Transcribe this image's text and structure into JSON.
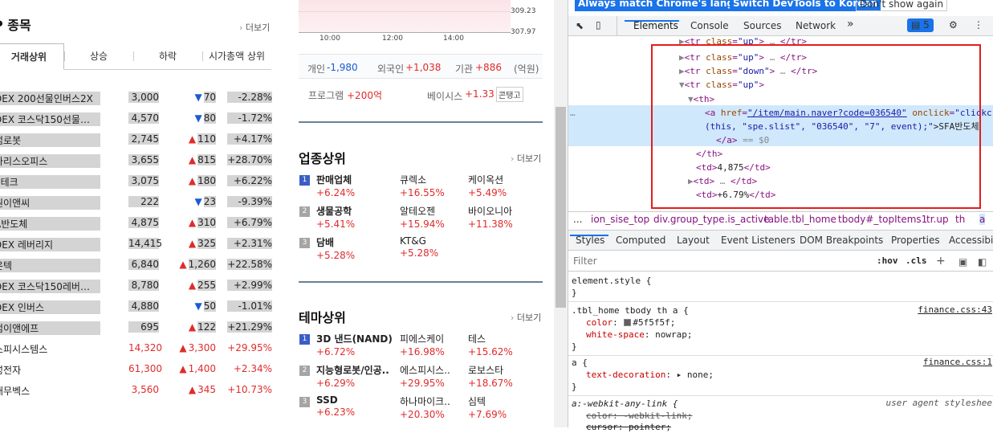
{
  "left": {
    "title": "P 종목",
    "more": "더보기",
    "tabs": [
      "거래상위",
      "상승",
      "하락",
      "시가총액 상위"
    ],
    "rows": [
      {
        "name": "DEX 200선물인버스2X",
        "price": "3,000",
        "chg": "70",
        "dir": "down",
        "pct": "-2.28%",
        "hl": true
      },
      {
        "name": "DEX 코스닥150선물…",
        "price": "4,570",
        "chg": "80",
        "dir": "down",
        "pct": "-1.72%",
        "hl": true
      },
      {
        "name": "럼로봇",
        "price": "2,745",
        "chg": "110",
        "dir": "up",
        "pct": "+4.17%",
        "hl": true
      },
      {
        "name": "라리스오피스",
        "price": "3,655",
        "chg": "815",
        "dir": "up",
        "pct": "+28.70%",
        "hl": true
      },
      {
        "name": "S테크",
        "price": "3,075",
        "chg": "180",
        "dir": "up",
        "pct": "+6.22%",
        "hl": true
      },
      {
        "name": "원이앤씨",
        "price": "222",
        "chg": "23",
        "dir": "down",
        "pct": "-9.39%",
        "hl": true
      },
      {
        "name": "A반도체",
        "price": "4,875",
        "chg": "310",
        "dir": "up",
        "pct": "+6.79%",
        "hl": true
      },
      {
        "name": "DEX 레버리지",
        "price": "14,415",
        "chg": "325",
        "dir": "up",
        "pct": "+2.31%",
        "hl": true
      },
      {
        "name": "온텍",
        "price": "6,840",
        "chg": "1,260",
        "dir": "up",
        "pct": "+22.58%",
        "hl": true
      },
      {
        "name": "DEX 코스닥150레버…",
        "price": "8,780",
        "chg": "255",
        "dir": "up",
        "pct": "+2.99%",
        "hl": true
      },
      {
        "name": "DEX 인버스",
        "price": "4,880",
        "chg": "50",
        "dir": "down",
        "pct": "-1.01%",
        "hl": true
      },
      {
        "name": "덤이앤에프",
        "price": "695",
        "chg": "122",
        "dir": "up",
        "pct": "+21.29%",
        "hl": true
      },
      {
        "name": "스피시스템스",
        "price": "14,320",
        "chg": "3,300",
        "dir": "up",
        "pct": "+29.95%",
        "hl": false
      },
      {
        "name": "성전자",
        "price": "61,300",
        "chg": "1,400",
        "dir": "up",
        "pct": "+2.34%",
        "hl": false
      },
      {
        "name": "대무벡스",
        "price": "3,560",
        "chg": "345",
        "dir": "up",
        "pct": "+10.73%",
        "hl": false
      }
    ]
  },
  "chart": {
    "y_labels": [
      "309.23",
      "307.97"
    ],
    "x_labels": [
      "10:00",
      "12:00",
      "14:00"
    ]
  },
  "invest": {
    "personal_label": "개인",
    "personal_val": "-1,980",
    "foreign_label": "외국인",
    "foreign_val": "+1,038",
    "inst_label": "기관",
    "inst_val": "+886",
    "unit": "(억원)"
  },
  "program": {
    "prog_label": "프로그램",
    "prog_val": "+200억",
    "basis_label": "베이시스",
    "basis_val": "+1.33",
    "contango": "콘탱고"
  },
  "industry": {
    "title": "업종상위",
    "more": "더보기",
    "rows": [
      {
        "rank": "1",
        "items": [
          {
            "name": "판매업체",
            "pct": "+6.24%"
          },
          {
            "name": "큐렉소",
            "pct": "+16.55%"
          },
          {
            "name": "케이옥션",
            "pct": "+5.49%"
          }
        ]
      },
      {
        "rank": "2",
        "items": [
          {
            "name": "생물공학",
            "pct": "+5.41%"
          },
          {
            "name": "알테오젠",
            "pct": "+15.94%"
          },
          {
            "name": "바이오니아",
            "pct": "+11.38%"
          }
        ]
      },
      {
        "rank": "3",
        "items": [
          {
            "name": "담배",
            "pct": "+5.28%"
          },
          {
            "name": "KT&G",
            "pct": "+5.28%"
          }
        ]
      }
    ]
  },
  "theme": {
    "title": "테마상위",
    "more": "더보기",
    "rows": [
      {
        "rank": "1",
        "items": [
          {
            "name": "3D 낸드(NAND)",
            "pct": "+6.72%"
          },
          {
            "name": "피에스케이",
            "pct": "+16.98%"
          },
          {
            "name": "테스",
            "pct": "+15.62%"
          }
        ]
      },
      {
        "rank": "2",
        "items": [
          {
            "name": "지능형로봇/인공..",
            "pct": "+6.29%"
          },
          {
            "name": "에스피시스..",
            "pct": "+29.95%"
          },
          {
            "name": "로보스타",
            "pct": "+18.67%"
          }
        ]
      },
      {
        "rank": "3",
        "items": [
          {
            "name": "SSD",
            "pct": "+6.23%"
          },
          {
            "name": "하나마이크..",
            "pct": "+20.30%"
          },
          {
            "name": "심텍",
            "pct": "+7.69%"
          }
        ]
      }
    ]
  },
  "devtools": {
    "infobar": {
      "btn1": "Always match Chrome's language",
      "btn2": "Switch DevTools to Korean",
      "btn3": "Don't show again"
    },
    "tabs": [
      "Elements",
      "Console",
      "Sources",
      "Network",
      "»"
    ],
    "issues_count": "5",
    "dom": {
      "tr": "tr",
      "class_attr": "class",
      "up": "\"up\"",
      "down": "\"down\"",
      "ellipsis": "…",
      "th": "th",
      "a": "a",
      "href_attr": "href",
      "href_val": "\"/item/main.naver?code=036540\"",
      "onclick_attr": "onclick",
      "onclick_val": "\"clickcr",
      "onclick_cont": "(this, \"spe.slist\", \"036540\", \"7\", event);\"",
      "link_text": ">SFA반도체",
      "dollar": "== $0",
      "td": "td",
      "td1_text": "4,875",
      "td3_text": "+6.79%",
      "dots": "…"
    },
    "breadcrumbs": [
      "...",
      "ion_sise_top",
      "div.group_type.is_active",
      "table.tbl_home",
      "tbody#_topItems1",
      "tr.up",
      "th",
      "a"
    ],
    "styles_tabs": [
      "Styles",
      "Computed",
      "Layout",
      "Event Listeners",
      "DOM Breakpoints",
      "Properties",
      "Accessibili"
    ],
    "filter_placeholder": "Filter",
    "filter_hov": ":hov",
    "filter_cls": ".cls",
    "rules": {
      "r1_selector": "element.style {",
      "r1_close": "}",
      "r2_selector": ".tbl_home tbody th a {",
      "r2_src": "finance.css:43",
      "r2_p1": "color",
      "r2_v1": "#5f5f5f;",
      "r2_p2": "white-space",
      "r2_v2": "nowrap;",
      "r2_close": "}",
      "r3_selector": "a {",
      "r3_src": "finance.css:1",
      "r3_p1": "text-decoration",
      "r3_v1": "none;",
      "r3_close": "}",
      "r4_selector": "a:-webkit-any-link {",
      "r4_src": "user agent styleshee",
      "r4_p1": "color: -webkit-link;",
      "r4_p2": "cursor: pointer;"
    },
    "swatch_color": "#5f5f5f",
    "selection_color": "#cfe8fc",
    "highlight_box_color": "#e21d1d"
  }
}
